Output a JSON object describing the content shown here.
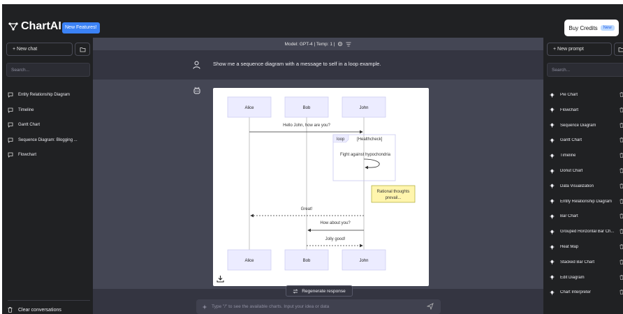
{
  "app": {
    "name": "ChartAI",
    "new_features_label": "New Features!"
  },
  "header": {
    "buy_credits_label": "Buy Credits",
    "buy_credits_badge": "New"
  },
  "left_sidebar": {
    "new_chat_label": "+  New chat",
    "search_placeholder": "Search...",
    "history": [
      {
        "label": "Entity Relationship Diagram"
      },
      {
        "label": "Timeline"
      },
      {
        "label": "Gantt Chart"
      },
      {
        "label": "Sequence Diagram: Blogging ..."
      },
      {
        "label": "Flowchart"
      }
    ],
    "clear_label": "Clear conversations"
  },
  "main": {
    "model_label": "Model: GPT-4 | Temp: 1 |",
    "user_message": "Show me a sequence diagram with a message to self in a loop example.",
    "regenerate_label": "Regenerate response",
    "input_placeholder": "Type \"/\" to see the available charts. Input your idea or data"
  },
  "diagram": {
    "actors": [
      "Alice",
      "Bob",
      "John"
    ],
    "messages": [
      {
        "from": "Alice",
        "to": "John",
        "text": "Hello John, how are you?",
        "style": "solid"
      },
      {
        "from": "John",
        "to": "Alice",
        "text": "Great!",
        "style": "dashed"
      },
      {
        "from": "John",
        "to": "Bob",
        "text": "How about you?",
        "style": "solid"
      },
      {
        "from": "Bob",
        "to": "John",
        "text": "Jolly good!",
        "style": "dashed"
      }
    ],
    "loop": {
      "keyword": "loop",
      "condition": "[Healthcheck]",
      "self_message": "Fight against hypochondria"
    },
    "note": {
      "line1": "Rational thoughts",
      "line2": "prevail..."
    }
  },
  "right_sidebar": {
    "new_prompt_label": "+  New prompt",
    "search_placeholder": "Search...",
    "prompts": [
      {
        "label": "Pie Chart"
      },
      {
        "label": "Flowchart"
      },
      {
        "label": "Sequence Diagram"
      },
      {
        "label": "Gantt Chart"
      },
      {
        "label": "Timeline"
      },
      {
        "label": "Donut Chart"
      },
      {
        "label": "Data Visualization"
      },
      {
        "label": "Entity Relationship Diagram"
      },
      {
        "label": "Bar Chart"
      },
      {
        "label": "Grouped Horizontal Bar Ch..."
      },
      {
        "label": "Heat Map"
      },
      {
        "label": "Stacked Bar Chart"
      },
      {
        "label": "Edit Diagram"
      },
      {
        "label": "Chart Interpreter"
      }
    ]
  },
  "colors": {
    "accent": "#3b82f6",
    "sidebar_bg": "#202123",
    "main_bg": "#343541",
    "bot_row_bg": "#444654",
    "note_bg": "#fff5ad"
  }
}
